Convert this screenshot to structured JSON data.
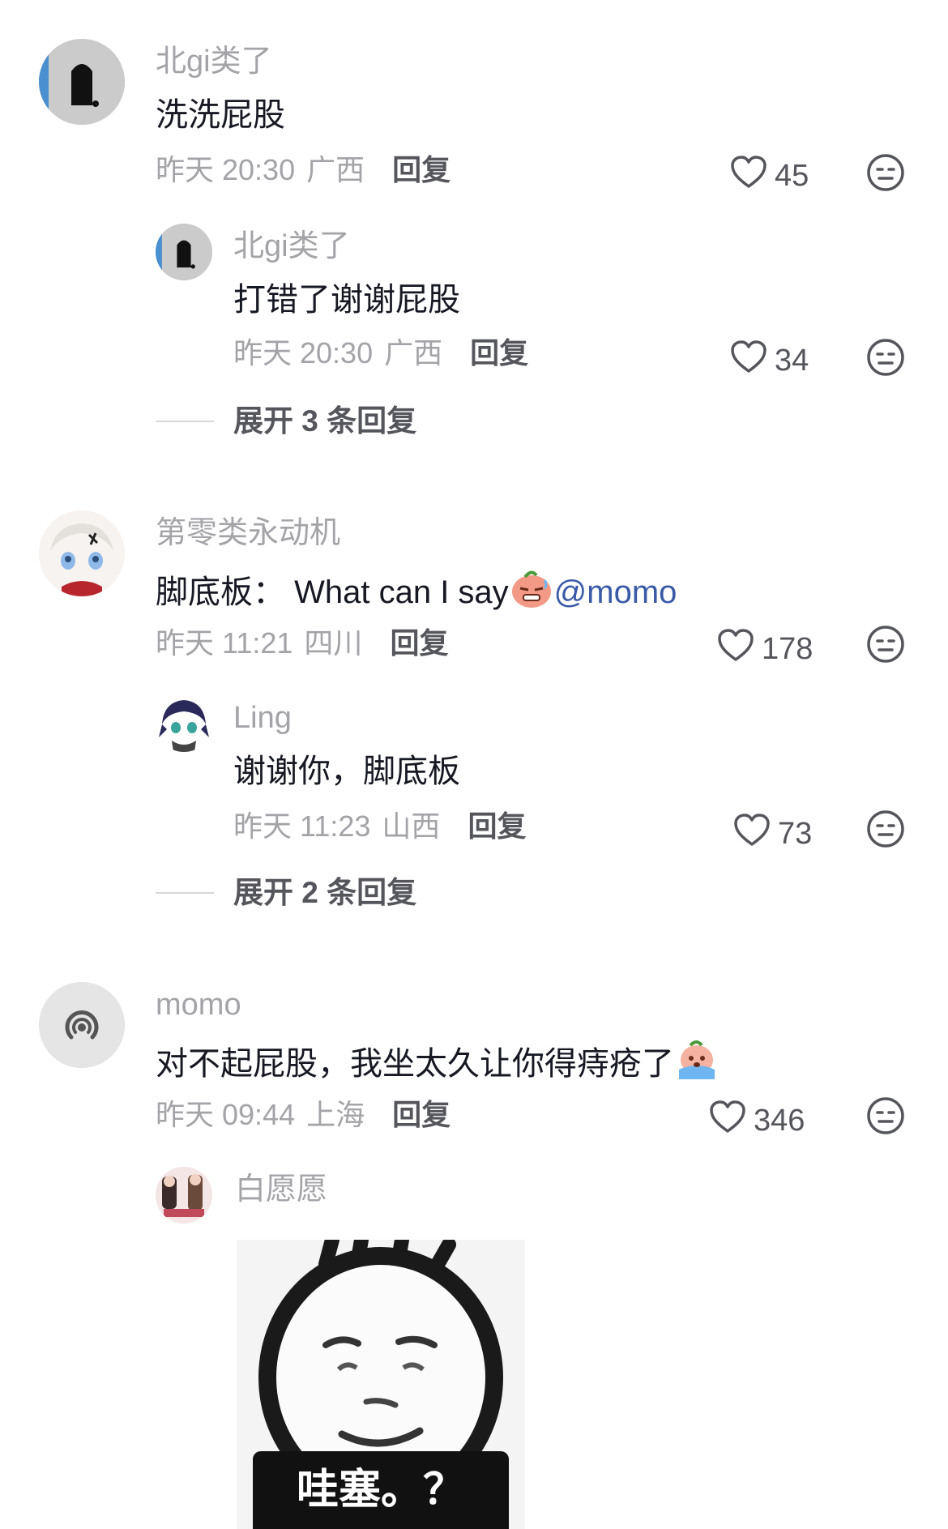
{
  "comments": [
    {
      "username": "北gi类了",
      "text": "洗洗屁股",
      "time": "昨天 20:30",
      "location": "广西",
      "reply_label": "回复",
      "likes": "45",
      "replies": [
        {
          "username": "北gi类了",
          "text": "打错了谢谢屁股",
          "time": "昨天 20:30",
          "location": "广西",
          "reply_label": "回复",
          "likes": "34"
        }
      ],
      "expand_label": "展开 3 条回复"
    },
    {
      "username": "第零类永动机",
      "text_prefix": "脚底板：  What can I say",
      "text_mention": "@momo",
      "time": "昨天 11:21",
      "location": "四川",
      "reply_label": "回复",
      "likes": "178",
      "replies": [
        {
          "username": "Ling",
          "text": "谢谢你，脚底板",
          "time": "昨天 11:23",
          "location": "山西",
          "reply_label": "回复",
          "likes": "73"
        }
      ],
      "expand_label": "展开 2 条回复"
    },
    {
      "username": "momo",
      "text": "对不起屁股，我坐太久让你得痔疮了",
      "time": "昨天 09:44",
      "location": "上海",
      "reply_label": "回复",
      "likes": "346",
      "replies": [
        {
          "username": "白愿愿",
          "sticker_caption": "哇塞。？"
        }
      ]
    }
  ],
  "icons": {
    "like": "heart-outline-icon",
    "dislike": "meh-face-icon"
  },
  "colors": {
    "username": "#a3a3a8",
    "text": "#161823",
    "meta": "#a3a3a8",
    "action": "#55565c",
    "mention": "#3a5aa8"
  }
}
